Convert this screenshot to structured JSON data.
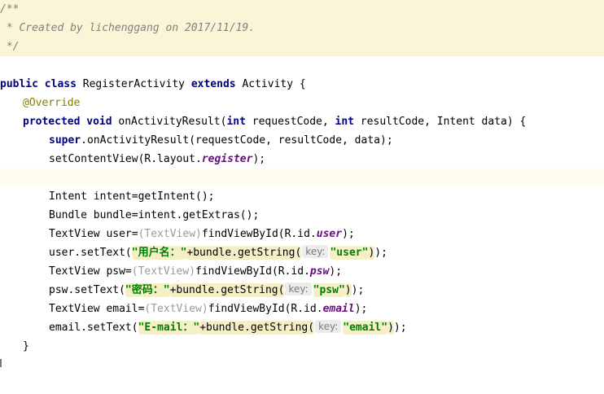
{
  "editor": {
    "lines": [
      {
        "bg": "doc",
        "indent": 0,
        "tokens": [
          {
            "t": "/**",
            "c": "comment"
          }
        ]
      },
      {
        "bg": "doc",
        "indent": 0,
        "tokens": [
          {
            "t": " * Created by lichenggang on 2017/11/19.",
            "c": "comment"
          }
        ]
      },
      {
        "bg": "doc",
        "indent": 0,
        "tokens": [
          {
            "t": " */",
            "c": "comment"
          }
        ]
      },
      {
        "bg": "",
        "indent": 0,
        "tokens": []
      },
      {
        "bg": "",
        "indent": 0,
        "tokens": [
          {
            "t": "public class ",
            "c": "kw"
          },
          {
            "t": "RegisterActivity ",
            "c": ""
          },
          {
            "t": "extends ",
            "c": "kw"
          },
          {
            "t": "Activity {",
            "c": ""
          }
        ]
      },
      {
        "bg": "",
        "indent": 4,
        "tokens": [
          {
            "t": "@Override",
            "c": "annotation"
          }
        ]
      },
      {
        "bg": "",
        "indent": 4,
        "tokens": [
          {
            "t": "protected void ",
            "c": "kw"
          },
          {
            "t": "onActivityResult(",
            "c": ""
          },
          {
            "t": "int ",
            "c": "kw"
          },
          {
            "t": "requestCode, ",
            "c": ""
          },
          {
            "t": "int ",
            "c": "kw"
          },
          {
            "t": "resultCode, Intent data) {",
            "c": ""
          }
        ]
      },
      {
        "bg": "",
        "indent": 8,
        "tokens": [
          {
            "t": "super",
            "c": "kw"
          },
          {
            "t": ".onActivityResult(requestCode, resultCode, data);",
            "c": ""
          }
        ]
      },
      {
        "bg": "",
        "indent": 8,
        "tokens": [
          {
            "t": "setContentView(R.layout.",
            "c": ""
          },
          {
            "t": "register",
            "c": "field"
          },
          {
            "t": ");",
            "c": ""
          }
        ]
      },
      {
        "bg": "caret",
        "indent": 0,
        "tokens": []
      },
      {
        "bg": "",
        "indent": 8,
        "tokens": [
          {
            "t": "Intent intent=getIntent();",
            "c": ""
          }
        ]
      },
      {
        "bg": "",
        "indent": 8,
        "tokens": [
          {
            "t": "Bundle bundle=intent.getExtras();",
            "c": ""
          }
        ]
      },
      {
        "bg": "",
        "indent": 8,
        "tokens": [
          {
            "t": "TextView user=",
            "c": ""
          },
          {
            "t": "(TextView)",
            "c": "cast"
          },
          {
            "t": "findViewById(R.id.",
            "c": ""
          },
          {
            "t": "user",
            "c": "field"
          },
          {
            "t": ");",
            "c": ""
          }
        ]
      },
      {
        "bg": "",
        "indent": 8,
        "tokens": [
          {
            "t": "user.setText(",
            "c": ""
          },
          {
            "t": "\"用户名：\"",
            "c": "str",
            "hl": true
          },
          {
            "t": "+bundle.getString(",
            "c": "",
            "hl": true
          },
          {
            "t": "key:",
            "c": "hint",
            "hl": true
          },
          {
            "t": "\"user\"",
            "c": "str",
            "hl": true
          },
          {
            "t": ")",
            "c": "",
            "hl": true
          },
          {
            "t": ");",
            "c": ""
          }
        ]
      },
      {
        "bg": "",
        "indent": 8,
        "tokens": [
          {
            "t": "TextView psw=",
            "c": ""
          },
          {
            "t": "(TextView)",
            "c": "cast"
          },
          {
            "t": "findViewById(R.id.",
            "c": ""
          },
          {
            "t": "psw",
            "c": "field"
          },
          {
            "t": ");",
            "c": ""
          }
        ]
      },
      {
        "bg": "",
        "indent": 8,
        "tokens": [
          {
            "t": "psw.setText(",
            "c": ""
          },
          {
            "t": "\"密码：\"",
            "c": "str",
            "hl": true
          },
          {
            "t": "+bundle.getString(",
            "c": "",
            "hl": true
          },
          {
            "t": "key:",
            "c": "hint",
            "hl": true
          },
          {
            "t": "\"psw\"",
            "c": "str",
            "hl": true
          },
          {
            "t": ")",
            "c": "",
            "hl": true
          },
          {
            "t": ");",
            "c": ""
          }
        ]
      },
      {
        "bg": "",
        "indent": 8,
        "tokens": [
          {
            "t": "TextView email=",
            "c": ""
          },
          {
            "t": "(TextView)",
            "c": "cast"
          },
          {
            "t": "findViewById(R.id.",
            "c": ""
          },
          {
            "t": "email",
            "c": "field"
          },
          {
            "t": ");",
            "c": ""
          }
        ]
      },
      {
        "bg": "",
        "indent": 8,
        "tokens": [
          {
            "t": "email.setText(",
            "c": ""
          },
          {
            "t": "\"E-mail：\"",
            "c": "str",
            "hl": true
          },
          {
            "t": "+bundle.getString(",
            "c": "",
            "hl": true
          },
          {
            "t": "key:",
            "c": "hint",
            "hl": true
          },
          {
            "t": "\"email\"",
            "c": "str",
            "hl": true
          },
          {
            "t": ")",
            "c": "",
            "hl": true
          },
          {
            "t": ");",
            "c": ""
          }
        ]
      },
      {
        "bg": "",
        "indent": 4,
        "tokens": [
          {
            "t": "}",
            "c": ""
          }
        ]
      }
    ]
  }
}
